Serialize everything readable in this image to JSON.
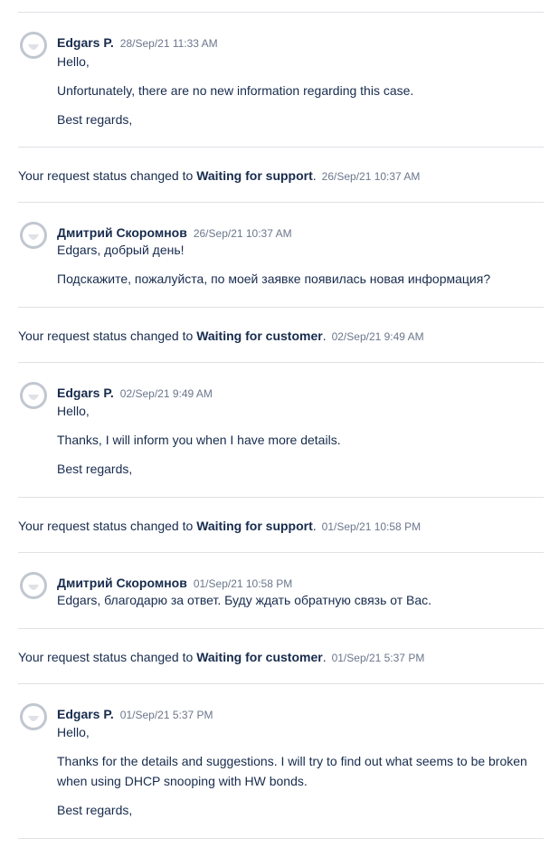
{
  "comments": [
    {
      "author": "Edgars P.",
      "time": "28/Sep/21 11:33 AM",
      "lines": [
        "Hello,",
        "Unfortunately, there are no new information regarding this case.",
        "Best regards,"
      ]
    },
    {
      "author": "Дмитрий Скоромнов",
      "time": "26/Sep/21 10:37 AM",
      "lines": [
        "Edgars, добрый день!",
        "Подскажите, пожалуйста, по моей заявке появилась новая информация?"
      ]
    },
    {
      "author": "Edgars P.",
      "time": "02/Sep/21 9:49 AM",
      "lines": [
        "Hello,",
        "Thanks, I will inform you when I have more details.",
        "Best regards,"
      ]
    },
    {
      "author": "Дмитрий Скоромнов",
      "time": "01/Sep/21 10:58 PM",
      "lines": [
        "Edgars, благодарю за ответ. Буду ждать обратную связь от Вас."
      ]
    },
    {
      "author": "Edgars P.",
      "time": "01/Sep/21 5:37 PM",
      "lines": [
        "Hello,",
        "Thanks for the details and suggestions. I will try to find out what seems to be broken",
        "when using DHCP snooping with HW bonds.",
        "Best regards,"
      ]
    }
  ],
  "status_changes": [
    {
      "prefix": "Your request status changed to",
      "status": "Waiting for support",
      "suffix": ".",
      "time": "26/Sep/21 10:37 AM"
    },
    {
      "prefix": "Your request status changed to",
      "status": "Waiting for customer",
      "suffix": ".",
      "time": "02/Sep/21 9:49 AM"
    },
    {
      "prefix": "Your request status changed to",
      "status": "Waiting for support",
      "suffix": ".",
      "time": "01/Sep/21 10:58 PM"
    },
    {
      "prefix": "Your request status changed to",
      "status": "Waiting for customer",
      "suffix": ".",
      "time": "01/Sep/21 5:37 PM"
    }
  ],
  "icons": {
    "avatar": "user-avatar-icon"
  },
  "colors": {
    "text": "#172b4d",
    "muted": "#6b778c",
    "divider": "#dfe1e6",
    "avatar_ring": "#c1c7d0"
  }
}
